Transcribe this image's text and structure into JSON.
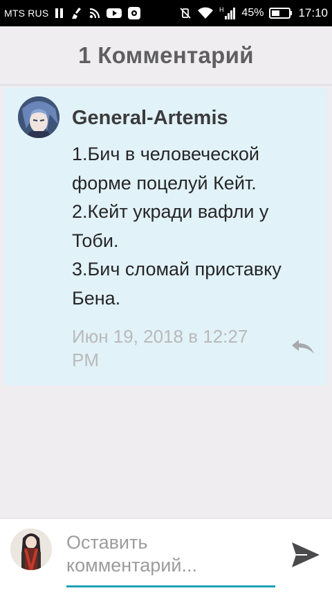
{
  "status_bar": {
    "carrier": "MTS RUS",
    "battery": "45%",
    "time": "17:10",
    "signal_label": "H"
  },
  "header": {
    "title": "1 Комментарий"
  },
  "comment": {
    "author": "General-Artemis",
    "lines": [
      "1.Бич в человеческой",
      "форме поцелуй Кейт.",
      "2.Кейт укради вафли у",
      "Тоби.",
      "3.Бич сломай приставку",
      "Бена."
    ],
    "date": "Июн 19, 2018 в 12:27 PM",
    "reply_icon": "reply-icon"
  },
  "composer": {
    "placeholder": "Оставить комментарий...",
    "send_icon": "send-icon"
  },
  "colors": {
    "card_bg": "#e1f2f8",
    "accent": "#1ea0b4",
    "page_bg": "#efedef"
  }
}
